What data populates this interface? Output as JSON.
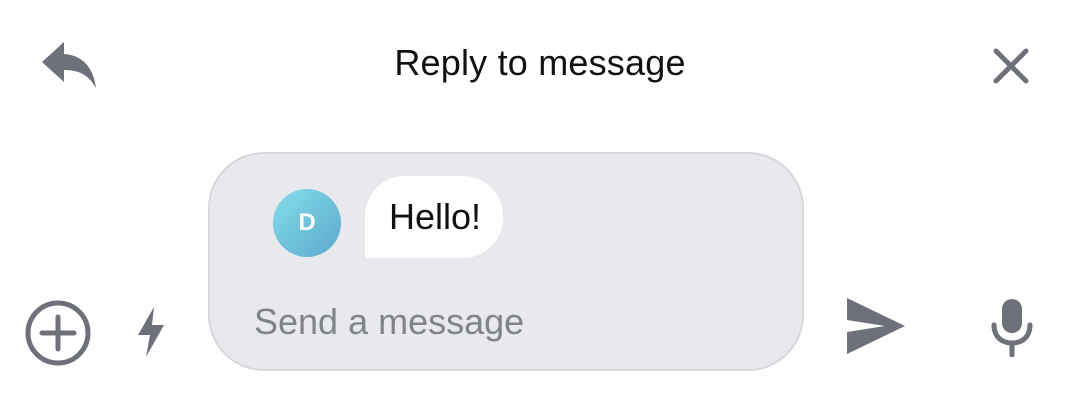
{
  "header": {
    "title": "Reply to message",
    "reply_icon": "reply-arrow-icon",
    "close_icon": "close-x-icon"
  },
  "compose": {
    "avatar_initial": "D",
    "quoted_message": "Hello!",
    "input_placeholder": "Send a message",
    "input_value": ""
  },
  "toolbar": {
    "left_icons": [
      "add-circle-icon",
      "lightning-bolt-icon"
    ],
    "right_icons": [
      "send-icon",
      "microphone-icon"
    ]
  },
  "colors": {
    "icon_gray": "#6e7179",
    "compose_bg": "#e8e9ed",
    "compose_border": "#d7d8dc",
    "avatar_gradient_start": "#86dde8",
    "avatar_gradient_end": "#5aa9cd",
    "placeholder_gray": "#80838a"
  }
}
